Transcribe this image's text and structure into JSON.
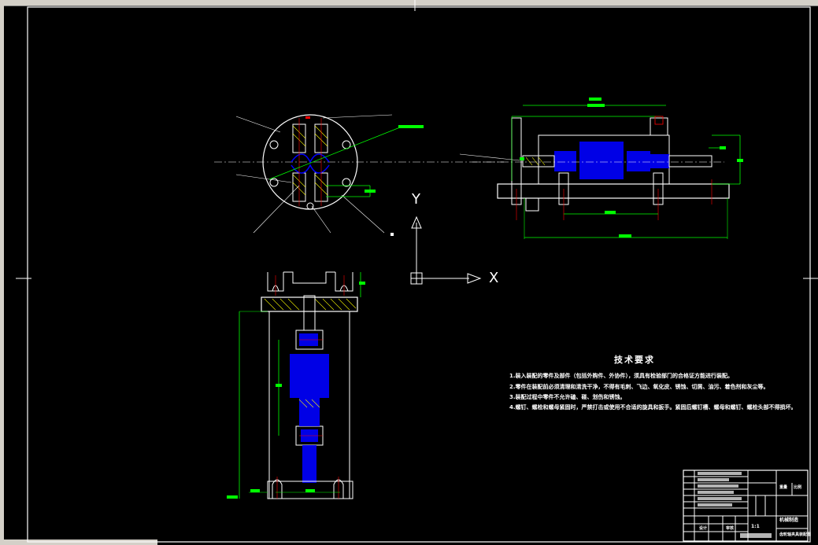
{
  "ucs": {
    "x_label": "X",
    "y_label": "Y"
  },
  "tech_requirements": {
    "title": "技术要求",
    "lines": [
      "1.装入装配的零件及部件（包括外购件、外协件），须具有检验部门的合格证方能进行装配。",
      "2.零件在装配前必须清理和清洗干净，不得有毛刺、飞边、氧化皮、锈蚀、切屑、油污、着色剂和灰尘等。",
      "3.装配过程中零件不允许磕、碰、划伤和锈蚀。",
      "4.螺钉、螺栓和螺母紧固时，严禁打击或使用不合适的旋具和扳手。紧固后螺钉槽、螺母和螺钉、螺栓头部不得损坏。"
    ]
  },
  "title_block": {
    "drawing_name": "齿轮轴夹具装配图",
    "school": "机械制造",
    "ratio": "1:1",
    "sheet": "共 张 第 张",
    "labels": [
      "标记",
      "处数",
      "分区",
      "更改文件号",
      "签名",
      "年月日",
      "设计",
      "审核",
      "工艺",
      "标准化",
      "批准",
      "阶段标记",
      "重量",
      "比例"
    ]
  },
  "colors": {
    "background": "#000000",
    "lines": "#ffffff",
    "dimension": "#00ff00",
    "part": "#0000ff",
    "center_mark": "#ff0000",
    "hatch": "#ffff00"
  }
}
